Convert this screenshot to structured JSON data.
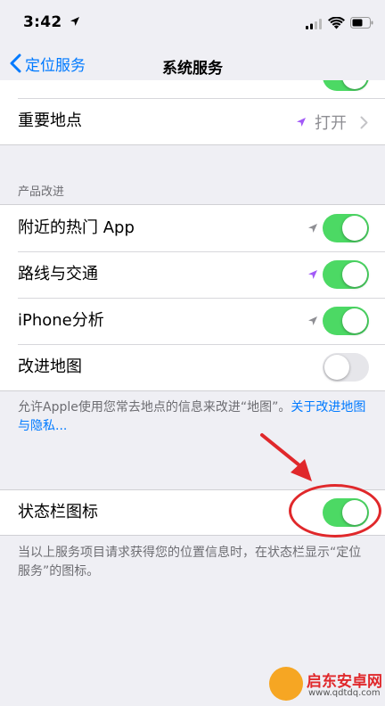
{
  "status": {
    "time": "3:42"
  },
  "nav": {
    "back_label": "定位服务",
    "title": "系统服务"
  },
  "top_row": {
    "label": "重要地点",
    "value": "打开"
  },
  "section_product": {
    "header": "产品改进",
    "items": [
      {
        "label": "附近的热门 App",
        "toggle": "on",
        "location_arrow_color": "#8e8e93"
      },
      {
        "label": "路线与交通",
        "toggle": "on",
        "location_arrow_color": "#a259f7"
      },
      {
        "label": "iPhone分析",
        "toggle": "on",
        "location_arrow_color": "#8e8e93"
      },
      {
        "label": "改进地图",
        "toggle": "off"
      }
    ],
    "footer_text": "允许Apple使用您常去地点的信息来改进“地图”。",
    "footer_link": "关于改进地图与隐私..."
  },
  "status_bar_icon": {
    "label": "状态栏图标",
    "toggle": "on",
    "footer": "当以上服务项目请求获得您的位置信息时，在状态栏显示“定位服务”的图标。"
  },
  "watermark": {
    "title": "启东安卓网",
    "url": "www.qdtdq.com"
  },
  "colors": {
    "accent": "#007aff",
    "toggle_on": "#4cd964",
    "annotation": "#e0282b",
    "location_purple": "#a259f7"
  }
}
